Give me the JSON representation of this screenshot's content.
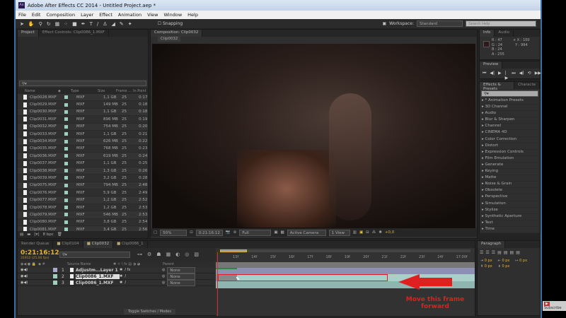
{
  "title": "Adobe After Effects CC 2014 - Untitled Project.aep *",
  "menu": [
    "File",
    "Edit",
    "Composition",
    "Layer",
    "Effect",
    "Animation",
    "View",
    "Window",
    "Help"
  ],
  "toolbar": {
    "snapping": "Snapping",
    "workspace_label": "Workspace:",
    "workspace_value": "Standard",
    "search_placeholder": "Search Help"
  },
  "project": {
    "tabs": [
      "Project",
      "Effect Controls: Clip0086_1.MXF"
    ],
    "columns": [
      "Name",
      "Type",
      "Size",
      "Frame ...",
      "In Point"
    ],
    "rows": [
      [
        "Clip0028.MXF",
        "MXF",
        "1,1 GB",
        "25",
        "0:17"
      ],
      [
        "Clip0029.MXF",
        "MXF",
        "149 MB",
        "25",
        "0:18"
      ],
      [
        "Clip0030.MXF",
        "MXF",
        "1,1 GB",
        "25",
        "0:18"
      ],
      [
        "Clip0031.MXF",
        "MXF",
        "896 MB",
        "25",
        "0:19"
      ],
      [
        "Clip0032.MXF",
        "MXF",
        "754 MB",
        "25",
        "0:20"
      ],
      [
        "Clip0033.MXF",
        "MXF",
        "1,1 GB",
        "25",
        "0:21"
      ],
      [
        "Clip0034.MXF",
        "MXF",
        "626 MB",
        "25",
        "0:22"
      ],
      [
        "Clip0035.MXF",
        "MXF",
        "768 MB",
        "25",
        "0:23"
      ],
      [
        "Clip0036.MXF",
        "MXF",
        "619 MB",
        "25",
        "0:24"
      ],
      [
        "Clip0037.MXF",
        "MXF",
        "1,1 GB",
        "25",
        "0:25"
      ],
      [
        "Clip0038.MXF",
        "MXF",
        "1,3 GB",
        "25",
        "0:26"
      ],
      [
        "Clip0039.MXF",
        "MXF",
        "3,2 GB",
        "25",
        "0:28"
      ],
      [
        "Clip0075.MXF",
        "MXF",
        "794 MB",
        "25",
        "2:48"
      ],
      [
        "Clip0076.MXF",
        "MXF",
        "5,9 GB",
        "25",
        "2:49"
      ],
      [
        "Clip0077.MXF",
        "MXF",
        "1,2 GB",
        "25",
        "2:52"
      ],
      [
        "Clip0078.MXF",
        "MXF",
        "1,2 GB",
        "25",
        "2:53"
      ],
      [
        "Clip0079.MXF",
        "MXF",
        "546 MB",
        "25",
        "2:53"
      ],
      [
        "Clip0080.MXF",
        "MXF",
        "3,8 GB",
        "25",
        "2:54"
      ],
      [
        "Clip0081.MXF",
        "MXF",
        "3,4 GB",
        "25",
        "2:56"
      ]
    ],
    "bpc": "8 bpc"
  },
  "composition": {
    "tab": "Composition: Clip0032",
    "subtab": "Clip0032",
    "zoom": "50%",
    "timecode": "0:21:16:12",
    "resolution": "Full",
    "camera": "Active Camera",
    "views": "1 View",
    "exposure": "+0,0"
  },
  "info": {
    "tabs": [
      "Info",
      "Audio"
    ],
    "r": "R : 47",
    "g": "G : 24",
    "b": "B : 24",
    "a": "A : 255",
    "x": "X : 100",
    "y": "Y : 994",
    "swatch": "#2f1818"
  },
  "preview": {
    "tab": "Preview"
  },
  "effects": {
    "tabs": [
      "Effects & Presets",
      "Characte"
    ],
    "items": [
      "* Animation Presets",
      "3D Channel",
      "Audio",
      "Blur & Sharpen",
      "Channel",
      "CINEMA 4D",
      "Color Correction",
      "Distort",
      "Expression Controls",
      "Film Emulation",
      "Generate",
      "Keying",
      "Matte",
      "Noise & Grain",
      "Obsolete",
      "Perspective",
      "Simulation",
      "Stylize",
      "Synthetic Aperture",
      "Text",
      "Time"
    ]
  },
  "timeline": {
    "tabs": [
      "Render Queue",
      "Clip0104",
      "Clip0032",
      "Clip0086_1"
    ],
    "timecode": "0:21:16:12",
    "frames": "31912 (25.00 fps)",
    "columns": {
      "source": "Source Name",
      "parent": "Parent"
    },
    "layers": [
      {
        "num": "1",
        "name": "Adjustm...Layer 1",
        "parent": "None",
        "color": "#a9a9d0"
      },
      {
        "num": "2",
        "name": "Clip0086_1.MXF",
        "parent": "None",
        "color": "#9ccfc0"
      },
      {
        "num": "3",
        "name": "Clip0086_1.MXF",
        "parent": "None",
        "color": "#9ccfc0"
      }
    ],
    "ruler": [
      "13f",
      "14f",
      "15f",
      "16f",
      "17f",
      "18f",
      "19f",
      "20f",
      "21f",
      "22f",
      "23f",
      "24f",
      "17:00f"
    ],
    "toggle": "Toggle Switches / Modes"
  },
  "paragraph": {
    "tab": "Paragraph",
    "values": [
      "0 px",
      "0 px",
      "0 px",
      "0 px",
      "0 px"
    ]
  },
  "annotation": {
    "text_line1": "Move this frame",
    "text_line2": "forward",
    "color": "#e02020"
  },
  "subscribe": "Subscribe"
}
